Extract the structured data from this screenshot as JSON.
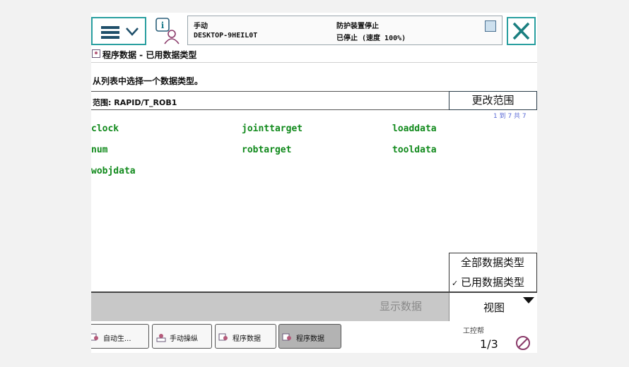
{
  "header": {
    "mode": "手动",
    "controller": "DESKTOP-9HEIL0T",
    "safety_status": "防护装置停止",
    "run_status": "已停止 (速度 100%)"
  },
  "page": {
    "title": "程序数据 - 已用数据类型",
    "instruction": "从列表中选择一个数据类型。",
    "scope_label": "范围: RAPID/T_ROB1",
    "change_scope": "更改范围",
    "counter": "1 到 7 共 7"
  },
  "data_types": [
    "clock",
    "jointtarget",
    "loaddata",
    "num",
    "robtarget",
    "tooldata",
    "wobjdata"
  ],
  "view_menu": {
    "options": [
      "全部数据类型",
      "已用数据类型"
    ],
    "checked": "已用数据类型",
    "label": "视图"
  },
  "actions": {
    "show_data": "显示数据"
  },
  "taskbar": {
    "items": [
      {
        "label": "自动生..."
      },
      {
        "label": "手动操纵"
      },
      {
        "label": "程序数据"
      },
      {
        "label": "程序数据"
      }
    ],
    "quickset": "1/3",
    "watermark": "工控帮"
  },
  "colors": {
    "accent": "#2a9fa0",
    "data_type_text": "#118a1c",
    "counter_text": "#5a6ad6"
  }
}
